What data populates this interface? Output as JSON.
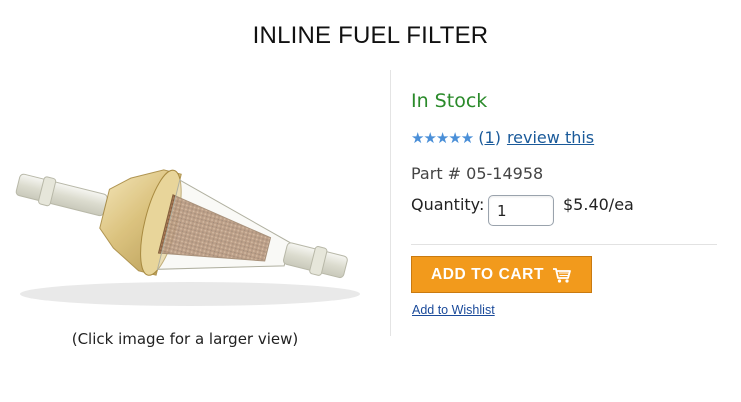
{
  "product": {
    "title": "INLINE FUEL FILTER",
    "image_caption": "(Click image for a larger view)",
    "stock_status": "In Stock",
    "rating": {
      "stars": "★★★★★",
      "open_paren": "(",
      "count": "1",
      "close_paren": ")",
      "review_link": "review this"
    },
    "part_number": "Part # 05-14958",
    "quantity_label": "Quantity:",
    "quantity_value": "1",
    "price": "$5.40/ea",
    "add_to_cart_label": "ADD TO CART",
    "cart_icon": "shopping-cart-icon",
    "wishlist_link": "Add to Wishlist"
  },
  "colors": {
    "in_stock": "#2a8a2a",
    "star": "#4a8fd8",
    "link": "#1a5a9a",
    "cart_button": "#f29a1c"
  }
}
